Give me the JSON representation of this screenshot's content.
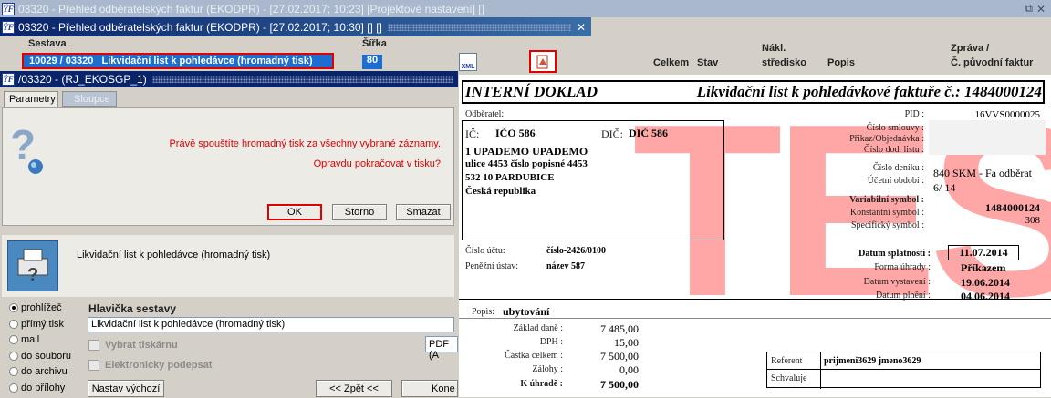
{
  "main_window": {
    "title": "03320 - Přehled odběratelských faktur (EKODPR) - [27.02.2017; 10:23]  [Projektové nastavení]  []",
    "restore_icon": "⧉",
    "close_icon": "✕"
  },
  "sub_window": {
    "title": "03320 - Přehled odběratelských faktur (EKODPR) - [27.02.2017; 10:30]  []  []",
    "col_sestava": "Sestava",
    "col_sirka": "Šířka",
    "selected_row": "10029 / 03320   Likvidační list k pohledávce (hromadný tisk)",
    "selected_width": "80"
  },
  "grid_headers": {
    "celkem": "Celkem",
    "stav": "Stav",
    "nakl": "Nákl.",
    "stredisko": "středisko",
    "popis": "Popis",
    "zprava": "Zpráva /",
    "puvodni": "Č. původní faktur"
  },
  "dialog": {
    "title": "/03320 - (RJ_EKOSGP_1)",
    "tab_params": "Parametry",
    "tab_columns": "Sloupce",
    "msg1": "Právě spouštíte hromadný tisk za všechny vybrané záznamy.",
    "msg2": "Opravdu pokračovat v tisku?",
    "ok": "OK",
    "storno": "Storno",
    "smazat": "Smazat",
    "report_name": "Likvidační list k pohledávce (hromadný tisk)",
    "options": [
      "prohlížeč",
      "přímý tisk",
      "mail",
      "do souboru",
      "do archivu",
      "do přílohy"
    ],
    "header_label": "Hlavička sestavy",
    "header_value": "Likvidační list k pohledávce (hromadný tisk)",
    "printer_label": "Vybrat tiskárnu",
    "esign_label": "Elektronicky podepsat",
    "format_value": "PDF (A",
    "default_btn": "Nastav výchozí",
    "back_btn": "<< Zpět <<",
    "next_btn": "Kone"
  },
  "doc": {
    "title_left": "INTERNÍ DOKLAD",
    "title_right": "Likvidační list k pohledávkové faktuře č.: 1484000124",
    "odberatel": "Odběratel:",
    "ic_label": "IČ:",
    "ic": "IČO 586",
    "dic_label": "DIČ:",
    "dic": "DIČ 586",
    "addr": [
      "1 UPADEMO UPADEMO",
      "ulice 4453 číslo popisné 4453",
      "532 10 PARDUBICE",
      "Česká republika"
    ],
    "right_labels": [
      "PID :",
      "Číslo smlouvy :",
      "Příkaz/Objednávka :",
      "Číslo dod. listu :",
      "Číslo deníku :",
      "Účetní období :",
      "Variabilní symbol :",
      "Konstantní symbol :",
      "Specifický symbol :"
    ],
    "pid": "16VVS0000025",
    "denik": "840 SKM - Fa odběrat",
    "obdobi": "6/ 14",
    "vs": "1484000124",
    "ks": "308",
    "ucet_label": "Číslo účtu:",
    "ucet": "číslo-2426/0100",
    "ustav_label": "Peněžní ústav:",
    "ustav": "název 587",
    "splatnost_label": "Datum splatnosti :",
    "splatnost": "11.07.2014",
    "forma_label": "Forma úhrady :",
    "forma": "Příkazem",
    "vystaveni_label": "Datum vystavení :",
    "vystaveni": "19.06.2014",
    "plneni_label": "Datum plnění :",
    "plneni": "04.06.2014",
    "popis_label": "Popis:",
    "popis": "ubytování",
    "sum_labels": [
      "Základ daně :",
      "DPH :",
      "Částka celkem :",
      "Zálohy :",
      "K úhradě :"
    ],
    "sum_values": [
      "7 485,00",
      "15,00",
      "7 500,00",
      "0,00",
      "7 500,00"
    ],
    "referent_label": "Referent",
    "referent": "prijmeni3629 jmeno3629",
    "schvaluje": "Schvaluje",
    "watermark": "TEST"
  },
  "colors": {
    "accent": "#0a246a",
    "red_highlight": "#e00000",
    "message": "#e00000"
  }
}
